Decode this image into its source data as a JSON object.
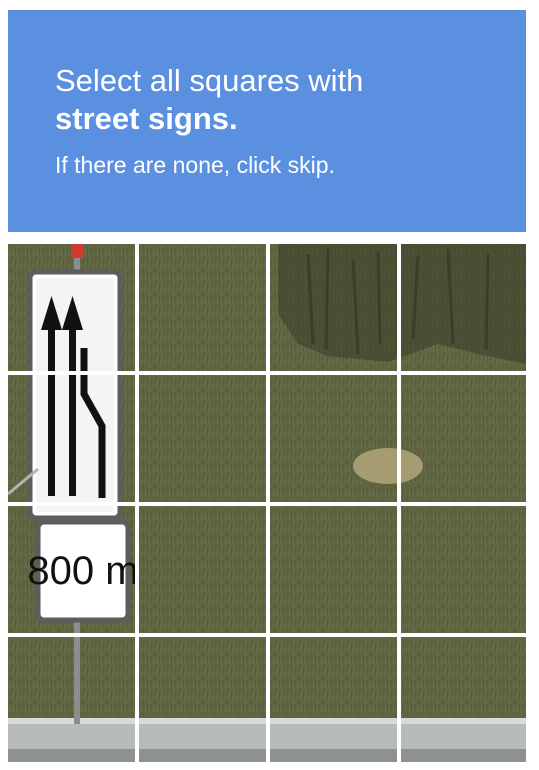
{
  "challenge": {
    "instruction_line1": "Select all squares with",
    "instruction_target": "street signs.",
    "instruction_hint": "If there are none, click skip."
  },
  "grid": {
    "rows": 4,
    "cols": 4,
    "sign_distance_text": "800 m"
  },
  "colors": {
    "header_bg": "#5b8fdf",
    "header_text": "#ffffff",
    "grid_line": "#ffffff",
    "grass": "#5f6540"
  },
  "icons": {
    "lane_sign": "lane-merge-arrows-icon"
  }
}
